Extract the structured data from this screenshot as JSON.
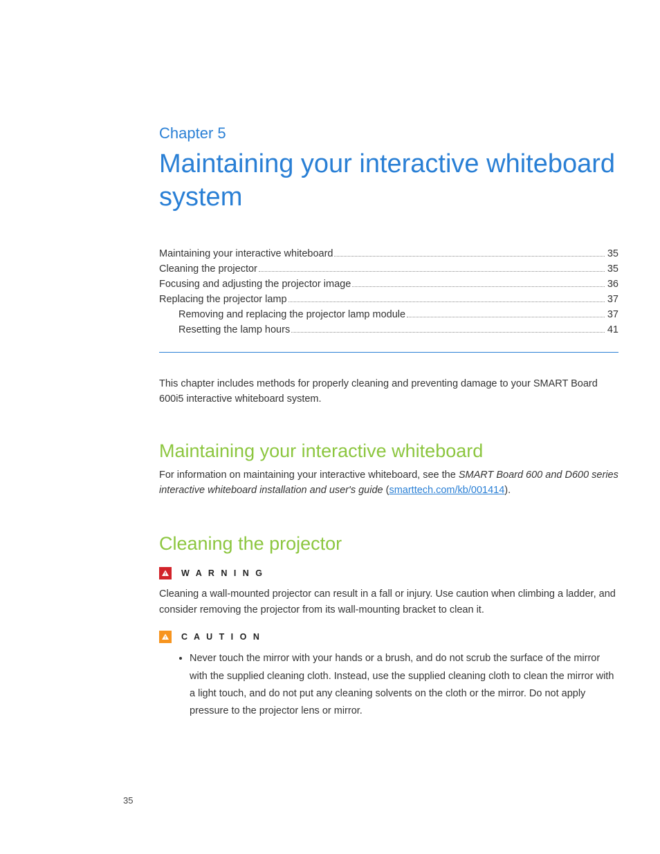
{
  "chapter": {
    "label": "Chapter 5",
    "title": "Maintaining your interactive whiteboard system"
  },
  "toc": [
    {
      "label": "Maintaining your interactive whiteboard",
      "page": "35",
      "indent": false
    },
    {
      "label": "Cleaning the projector",
      "page": "35",
      "indent": false
    },
    {
      "label": "Focusing and adjusting the projector image",
      "page": "36",
      "indent": false
    },
    {
      "label": "Replacing the projector lamp",
      "page": "37",
      "indent": false
    },
    {
      "label": "Removing and replacing the projector lamp module",
      "page": "37",
      "indent": true
    },
    {
      "label": "Resetting the lamp hours",
      "page": "41",
      "indent": true
    }
  ],
  "intro": "This chapter includes methods for properly cleaning and preventing damage to your SMART Board 600i5 interactive whiteboard system.",
  "section1": {
    "heading": "Maintaining your interactive whiteboard",
    "pre": "For information on maintaining your interactive whiteboard, see the ",
    "em": "SMART Board 600 and D600 series interactive whiteboard installation and user's guide",
    "mid": " (",
    "link": "smarttech.com/kb/001414",
    "post": ")."
  },
  "section2": {
    "heading": "Cleaning the projector",
    "warning_label": "W A R N I N G",
    "warning_body": "Cleaning a wall-mounted projector can result in a fall or injury. Use caution when climbing a ladder, and consider removing the projector from its wall-mounting bracket to clean it.",
    "caution_label": "C A U T I O N",
    "caution_item": "Never touch the mirror with your hands or a brush, and do not scrub the surface of the mirror with the supplied cleaning cloth. Instead, use the supplied cleaning cloth to clean the mirror with a light touch, and do not put any cleaning solvents on the cloth or the mirror. Do not apply pressure to the projector lens or mirror."
  },
  "page_number": "35"
}
